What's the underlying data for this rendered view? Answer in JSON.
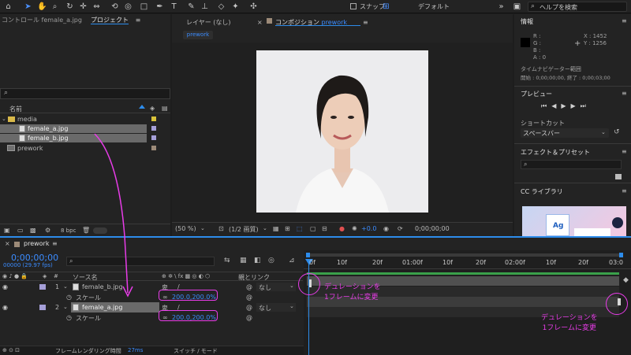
{
  "toolbar": {
    "snap_label": "スナップ",
    "workspace_label": "デフォルト",
    "search_placeholder": "ヘルプを検索"
  },
  "project": {
    "control_tab": "コントロール female_a.jpg",
    "project_tab": "プロジェクト",
    "col_name": "名前",
    "folder": "media",
    "items": [
      "female_a.jpg",
      "female_b.jpg",
      "prework"
    ],
    "bpc": "8 bpc"
  },
  "viewer": {
    "layer_tab": "レイヤー (なし)",
    "comp_tab": "コンポジション",
    "comp_name": "prework",
    "subtab": "prework",
    "zoom": "(50 %)",
    "resolution": "(1/2 画質)",
    "exposure": "+0.0",
    "timecode": "0;00;00;00"
  },
  "info": {
    "title": "情報",
    "r": "R :",
    "g": "G :",
    "b": "B :",
    "a": "A : 0",
    "x": "X : 1452",
    "y": "Y : 1256",
    "nav_label": "タイムナビゲーター範囲",
    "nav_range": "開始 : 0;00;00;00, 終了 : 0;00;03;00"
  },
  "preview": {
    "title": "プレビュー",
    "shortcut_label": "ショートカット",
    "shortcut_value": "スペースバー"
  },
  "effects": {
    "title": "エフェクト＆プリセット"
  },
  "library": {
    "title": "CC ライブラリ",
    "thumb_label": "Ag"
  },
  "timeline": {
    "tab": "prework",
    "timecode": "0;00;00;00",
    "fps": "00000 (29.97 fps)",
    "col_source": "ソース名",
    "col_parent": "親とリンク",
    "layers": [
      {
        "num": "1",
        "name": "female_b.jpg",
        "parent": "なし",
        "prop": "スケール",
        "value": "200.0,200.0%"
      },
      {
        "num": "2",
        "name": "female_a.jpg",
        "parent": "なし",
        "prop": "スケール",
        "value": "200.0,200.0%"
      }
    ],
    "ruler": [
      "0f",
      "10f",
      "20f",
      "01:00f",
      "10f",
      "20f",
      "02:00f",
      "10f",
      "20f",
      "03:0"
    ],
    "status_render": "フレームレンダリング時間",
    "status_ms": "27ms",
    "status_switch": "スイッチ / モード"
  },
  "annotations": {
    "left": "デュレーションを\n1フレームに変更",
    "right": "デュレーションを\n1フレームに変更"
  },
  "colors": {
    "accent": "#2d8ceb",
    "annotation": "#e83ce8",
    "label_purple": "#a59fd8",
    "label_yellow": "#d8c23a"
  }
}
